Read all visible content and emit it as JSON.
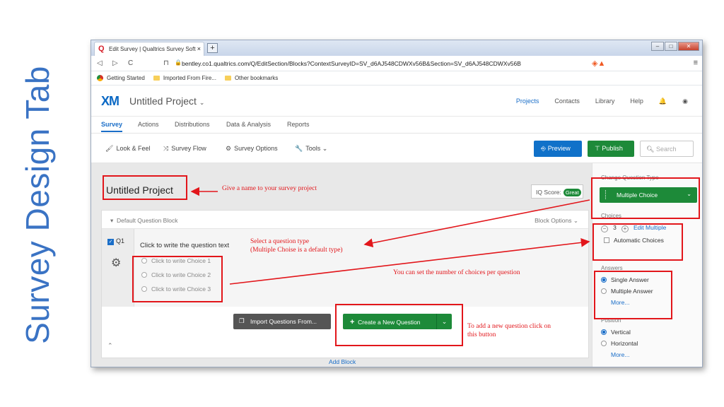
{
  "slide": {
    "title": "Survey Design Tab"
  },
  "browser": {
    "tab_title": "Edit Survey | Qualtrics Survey Soft",
    "tab_close": "×",
    "new_tab": "+",
    "url": "bentley.co1.qualtrics.com/Q/EditSection/Blocks?ContextSurveyID=SV_d6AJ548CDWXv56B&Section=SV_d6AJ548CDWXv56B",
    "bookmarks": [
      "Getting Started",
      "Imported From Fire...",
      "Other bookmarks"
    ]
  },
  "header": {
    "logo": "XM",
    "project": "Untitled Project",
    "nav": [
      "Projects",
      "Contacts",
      "Library",
      "Help"
    ]
  },
  "tabs": [
    "Survey",
    "Actions",
    "Distributions",
    "Data & Analysis",
    "Reports"
  ],
  "toolbar": {
    "look_feel": "Look & Feel",
    "survey_flow": "Survey Flow",
    "survey_options": "Survey Options",
    "tools": "Tools",
    "preview": "Preview",
    "publish": "Publish",
    "search_placeholder": "Search"
  },
  "main": {
    "title": "Untitled Project",
    "iq_label": "IQ Score:",
    "iq_value": "Great",
    "block_name": "Default Question Block",
    "block_options": "Block Options",
    "question_id": "Q1",
    "question_text": "Click to write the question text",
    "choices": [
      "Click to write Choice 1",
      "Click to write Choice 2",
      "Click to write Choice 3"
    ],
    "import_button": "Import Questions From...",
    "create_button": "Create a New Question",
    "add_block": "Add Block"
  },
  "side": {
    "change_type_label": "Change Question Type",
    "type_value": "Multiple Choice",
    "choices_label": "Choices",
    "choices_count": "3",
    "edit_multiple": "Edit Multiple",
    "automatic_choices": "Automatic Choices",
    "answers_label": "Answers",
    "single_answer": "Single Answer",
    "multiple_answer": "Multiple Answer",
    "more": "More...",
    "position_label": "Position",
    "vertical": "Vertical",
    "horizontal": "Horizontal",
    "more2": "More..."
  },
  "annotations": {
    "name_hint": "Give a name to your survey project",
    "type_hint_1": "Select a question type",
    "type_hint_2": "(Multiple Choise is a default type)",
    "choices_hint": "You can set the number of choices per question",
    "new_q_hint_1": "To add a new question click on",
    "new_q_hint_2": "this button"
  },
  "colors": {
    "slide_title": "#3a73c4",
    "qualtrics_blue": "#1071c9",
    "qualtrics_green": "#1d8a39",
    "annotation_red": "#e2161b"
  }
}
